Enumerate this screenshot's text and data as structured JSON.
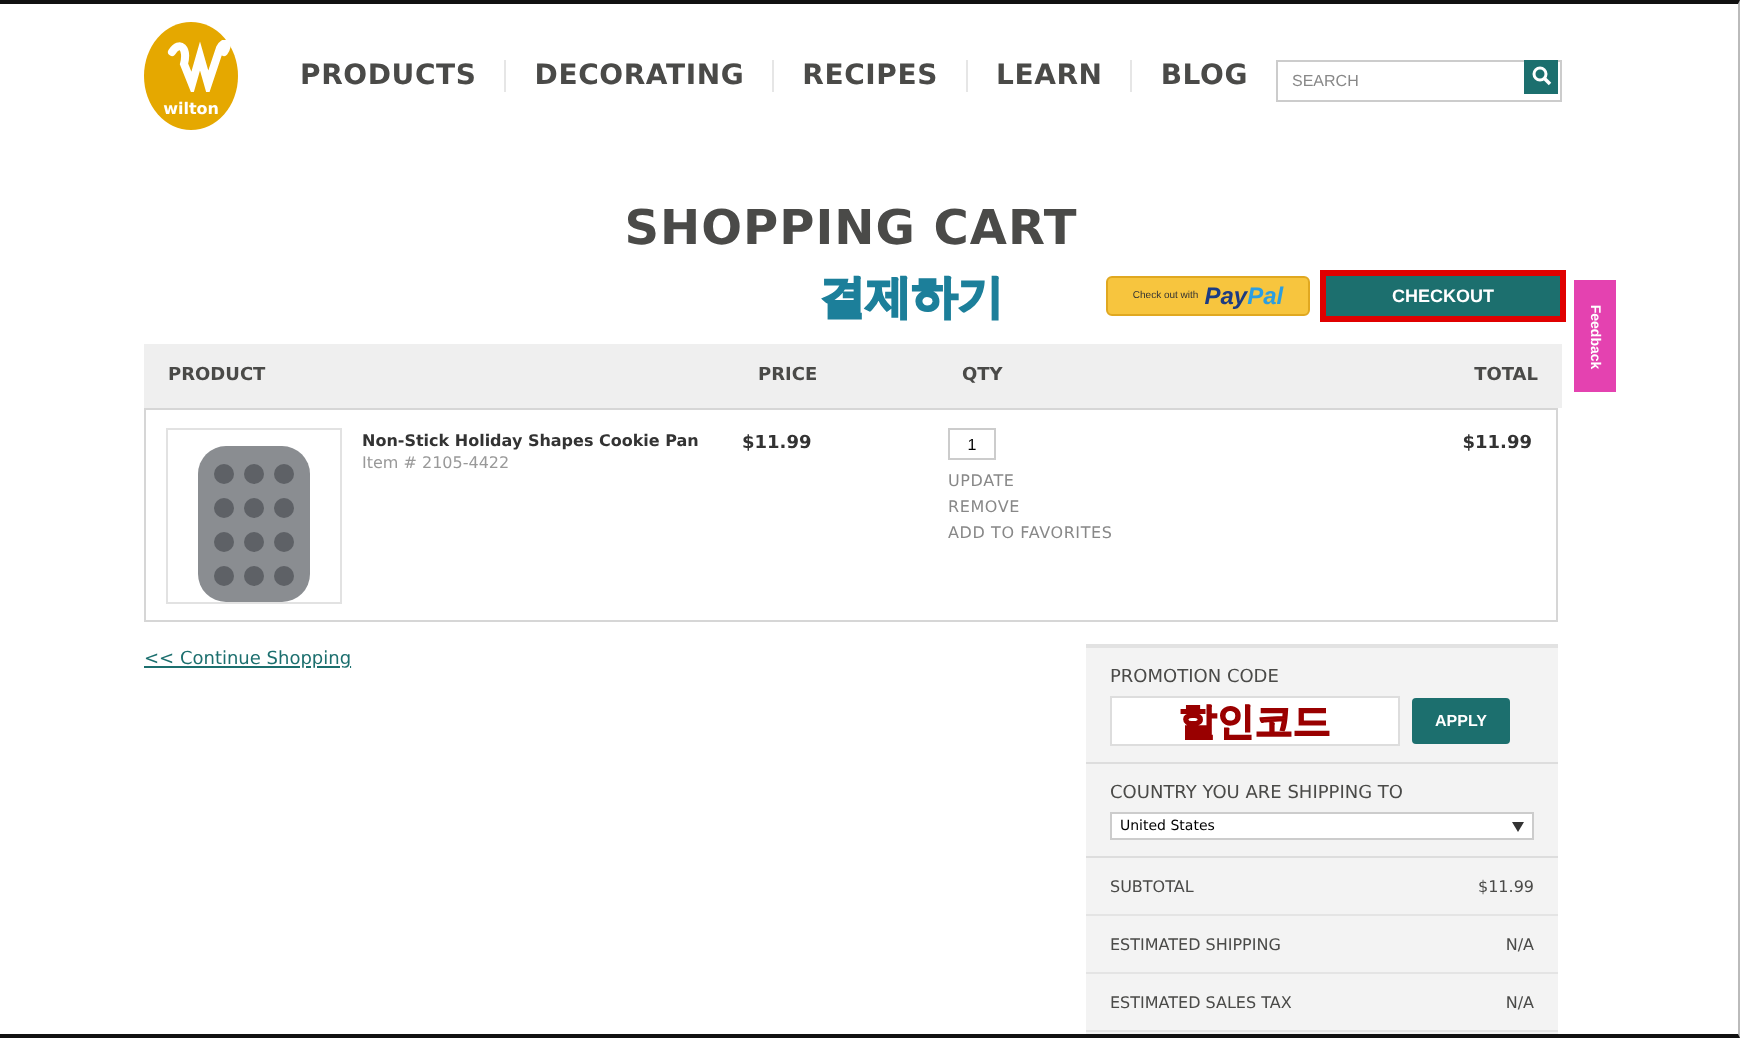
{
  "header": {
    "logo": "wilton",
    "nav": [
      "PRODUCTS",
      "DECORATING",
      "RECIPES",
      "LEARN",
      "BLOG"
    ],
    "search": {
      "placeholder": "SEARCH"
    }
  },
  "title": "SHOPPING CART",
  "checkout_note": "결제하기",
  "paypal": {
    "prefix": "Check out with",
    "brand_a": "Pay",
    "brand_b": "Pal"
  },
  "checkout": {
    "label": "CHECKOUT",
    "highlighted": true
  },
  "table": {
    "columns": [
      "PRODUCT",
      "PRICE",
      "QTY",
      "TOTAL"
    ],
    "rows": [
      {
        "name": "Non-Stick Holiday Shapes Cookie Pan",
        "item": "Item # 2105-4422",
        "price": "$11.99",
        "qty": "1",
        "actions": [
          "UPDATE",
          "REMOVE",
          "ADD TO FAVORITES"
        ],
        "total": "$11.99"
      }
    ]
  },
  "feedback": "Feedback",
  "continue": "<< Continue Shopping",
  "summary": {
    "promo_label": "PROMOTION CODE",
    "promo_note": "할인코드",
    "apply": "APPLY",
    "country_label": "COUNTRY YOU ARE SHIPPING TO",
    "country": "United States",
    "lines": [
      {
        "label": "SUBTOTAL",
        "value": "$11.99"
      },
      {
        "label": "ESTIMATED SHIPPING",
        "value": "N/A"
      },
      {
        "label": "ESTIMATED SALES TAX",
        "value": "N/A"
      }
    ]
  }
}
